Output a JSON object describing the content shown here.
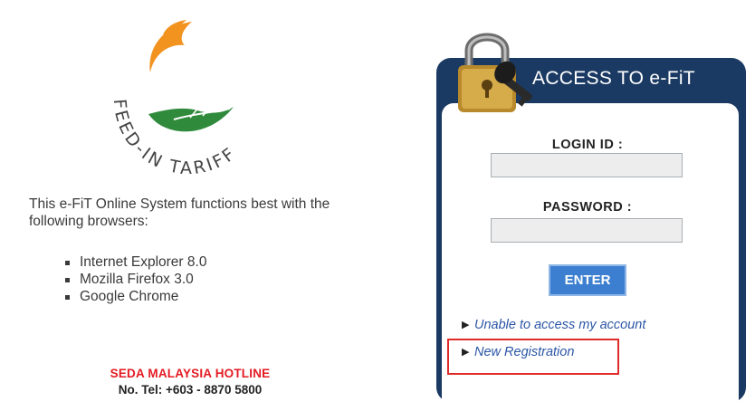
{
  "logo": {
    "icon": "feed-in-tariff-logo-icon",
    "text": "FEED-IN TARIFF",
    "colors": {
      "orange": "#f2921f",
      "green": "#2f8a3c"
    }
  },
  "intro": {
    "text": "This e-FiT Online System functions best with the following browsers:"
  },
  "browsers": [
    "Internet Explorer 8.0",
    "Mozilla Firefox 3.0",
    "Google Chrome"
  ],
  "hotline": {
    "title": "SEDA MALAYSIA HOTLINE",
    "tel": "No. Tel: +603 - 8870 5800"
  },
  "panel": {
    "title": "ACCESS TO e-FiT",
    "icon": "padlock-key-icon",
    "login_label": "LOGIN ID :",
    "login_value": "",
    "password_label": "PASSWORD :",
    "password_value": "",
    "enter_label": "ENTER",
    "links": {
      "unable": "Unable to access my account",
      "new_registration": "New Registration"
    }
  },
  "colors": {
    "panel": "#1b3a63",
    "hotline": "#e31b23",
    "button": "#3c7fd0",
    "link": "#2b56a6",
    "highlight": "#e02a2a"
  }
}
